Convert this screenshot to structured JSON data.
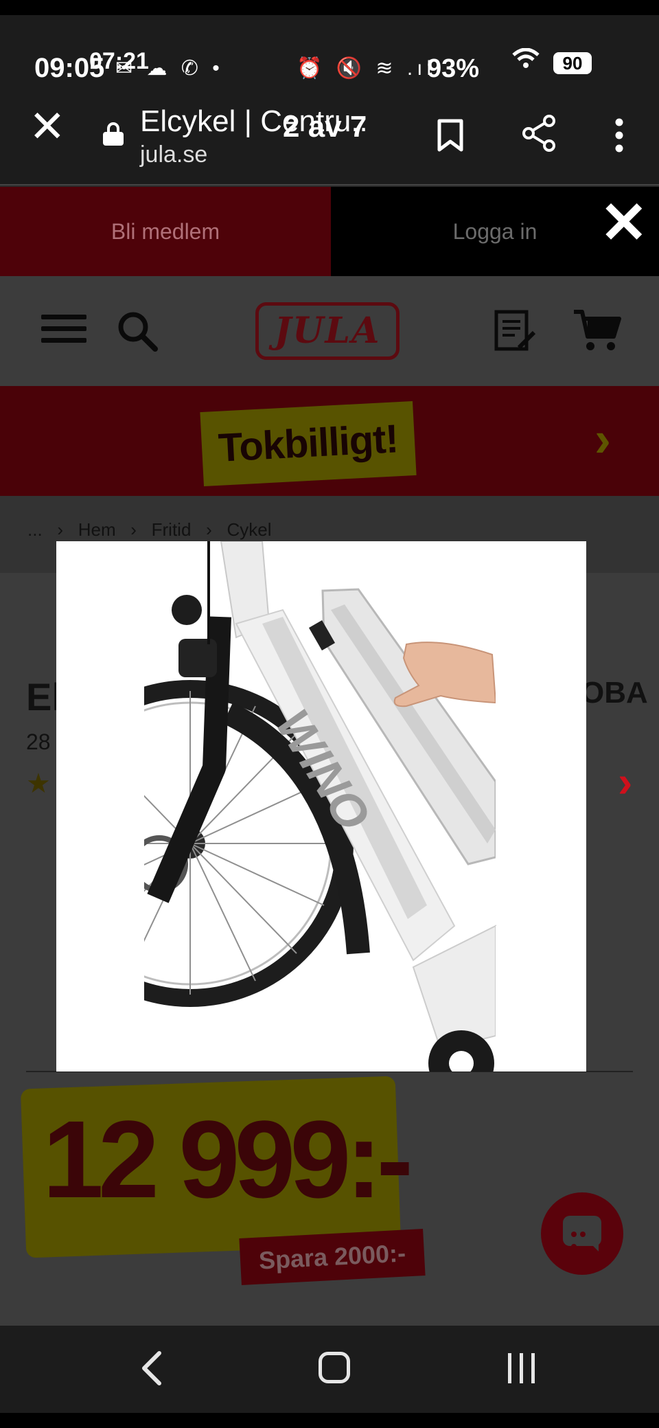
{
  "status_bar": {
    "time": "09:05",
    "time_overlay": "07:21",
    "notification_icons": "✉ ☁ ✆ •",
    "system_icons": "⏰ 🔇 ≋ .ıl",
    "battery": "93%",
    "battery_overlay": "90"
  },
  "browser": {
    "page_title": "Elcykel | Centru..",
    "image_counter": "2 av 7",
    "domain": "jula.se"
  },
  "member_bar": {
    "member_label": "Bli medlem",
    "login_label": "Logga in"
  },
  "header": {
    "logo_text": "JULA"
  },
  "promo": {
    "label": "Tokbilligt!"
  },
  "breadcrumb": {
    "items": [
      "...",
      "Hem",
      "Fritid",
      "Cykel"
    ]
  },
  "product": {
    "title_start": "El",
    "title_end": "OBA",
    "subtitle_start": "28"
  },
  "price": {
    "value": "12 999:-",
    "saving": "Spara 2000:-"
  },
  "viewer": {
    "image_brand_text": "WINO"
  },
  "colors": {
    "brand_red": "#d0101c",
    "brand_yellow": "#ffee00",
    "overlay_dim": "#3c3c3c"
  }
}
